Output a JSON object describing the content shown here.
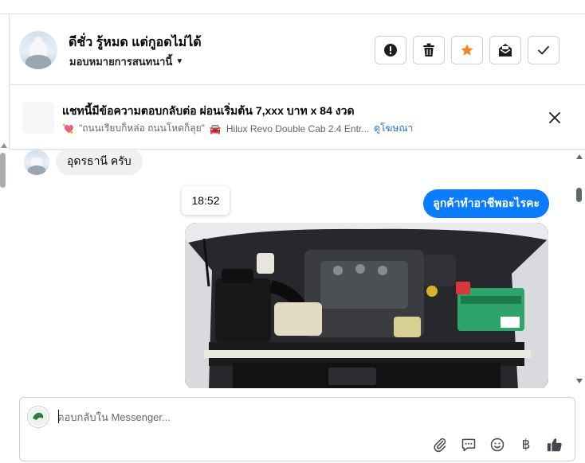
{
  "header": {
    "contact_name": "ดีชั่ว รู้หมด แต่กูอดไม่ได้",
    "assign_label": "มอบหมายการสนทนานี้",
    "actions": [
      {
        "icon": "alert-icon",
        "name": "report-button"
      },
      {
        "icon": "trash-icon",
        "name": "delete-button"
      },
      {
        "icon": "star-icon",
        "name": "star-button"
      },
      {
        "icon": "mark-unread-icon",
        "name": "mark-unread-button"
      },
      {
        "icon": "checkmark-icon",
        "name": "mark-done-button"
      }
    ]
  },
  "ad_banner": {
    "title": "แชทนี้มีข้อความตอบกลับต่อ ผ่อนเริ่มต้น 7,xxx บาท x 84 งวด",
    "subtitle": "\"ถนนเรียบก็หล่อ ถนนโหดก็ลุย\"",
    "model": "Hilux Revo Double Cab 2.4 Entr...",
    "link_label": "ดูโฆษณา"
  },
  "messages": {
    "incoming_text": "อุดรธานี ครับ",
    "timestamp": "18:52",
    "outgoing_text": "ลูกค้าทำอาชีพอะไรคะ"
  },
  "composer": {
    "placeholder": "ตอบกลับใน Messenger..."
  },
  "colors": {
    "accent": "#0a7cff",
    "star": "#f5831f",
    "link": "#216fdb"
  }
}
